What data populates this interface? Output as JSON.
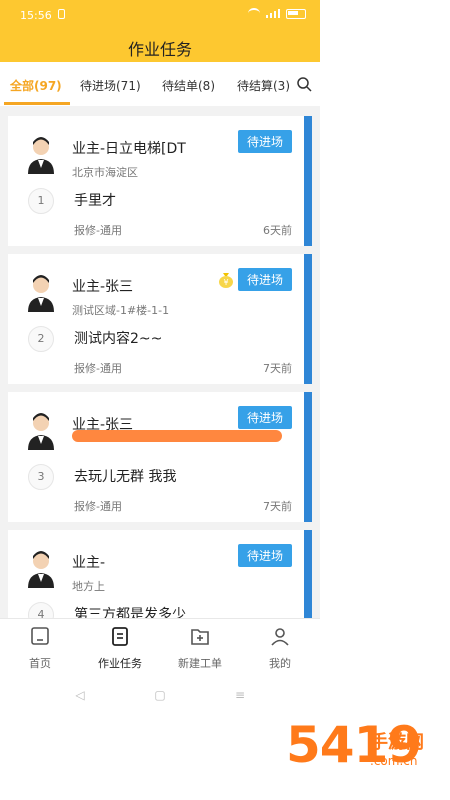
{
  "status_bar": {
    "time": "15:56"
  },
  "header": {
    "title": "作业任务"
  },
  "tabs": [
    {
      "label": "全部(97)",
      "active": true
    },
    {
      "label": "待进场(71)",
      "active": false
    },
    {
      "label": "待结单(8)",
      "active": false
    },
    {
      "label": "待结算(3)",
      "active": false
    }
  ],
  "cards": [
    {
      "owner": "业主-日立电梯[DT",
      "location": "北京市海淀区",
      "index": "1",
      "content": "手里才",
      "type": "报修-通用",
      "ago": "6天前",
      "status": "待进场"
    },
    {
      "owner": "业主-张三",
      "location": "测试区域-1#楼-1-1",
      "index": "2",
      "content": "测试内容2~~",
      "type": "报修-通用",
      "ago": "7天前",
      "status": "待进场"
    },
    {
      "owner": "业主-张三",
      "location": "",
      "index": "3",
      "content": "去玩儿无群 我我",
      "type": "报修-通用",
      "ago": "7天前",
      "status": "待进场"
    },
    {
      "owner": "业主-",
      "location": "地方上",
      "index": "4",
      "content": "第三方都是发多少",
      "type": "",
      "ago": "",
      "status": "待进场"
    }
  ],
  "bottom_nav": [
    {
      "label": "首页",
      "icon": "home-icon"
    },
    {
      "label": "作业任务",
      "icon": "clipboard-icon"
    },
    {
      "label": "新建工单",
      "icon": "new-order-icon"
    },
    {
      "label": "我的",
      "icon": "user-icon"
    }
  ],
  "watermark": {
    "big": "5419",
    "cn": "手游网",
    "domain": ".com.cn"
  },
  "colors": {
    "header": "#fdc830",
    "accent": "#f5a623",
    "badge": "#36a1e8",
    "card_edge": "#2f86d6"
  }
}
